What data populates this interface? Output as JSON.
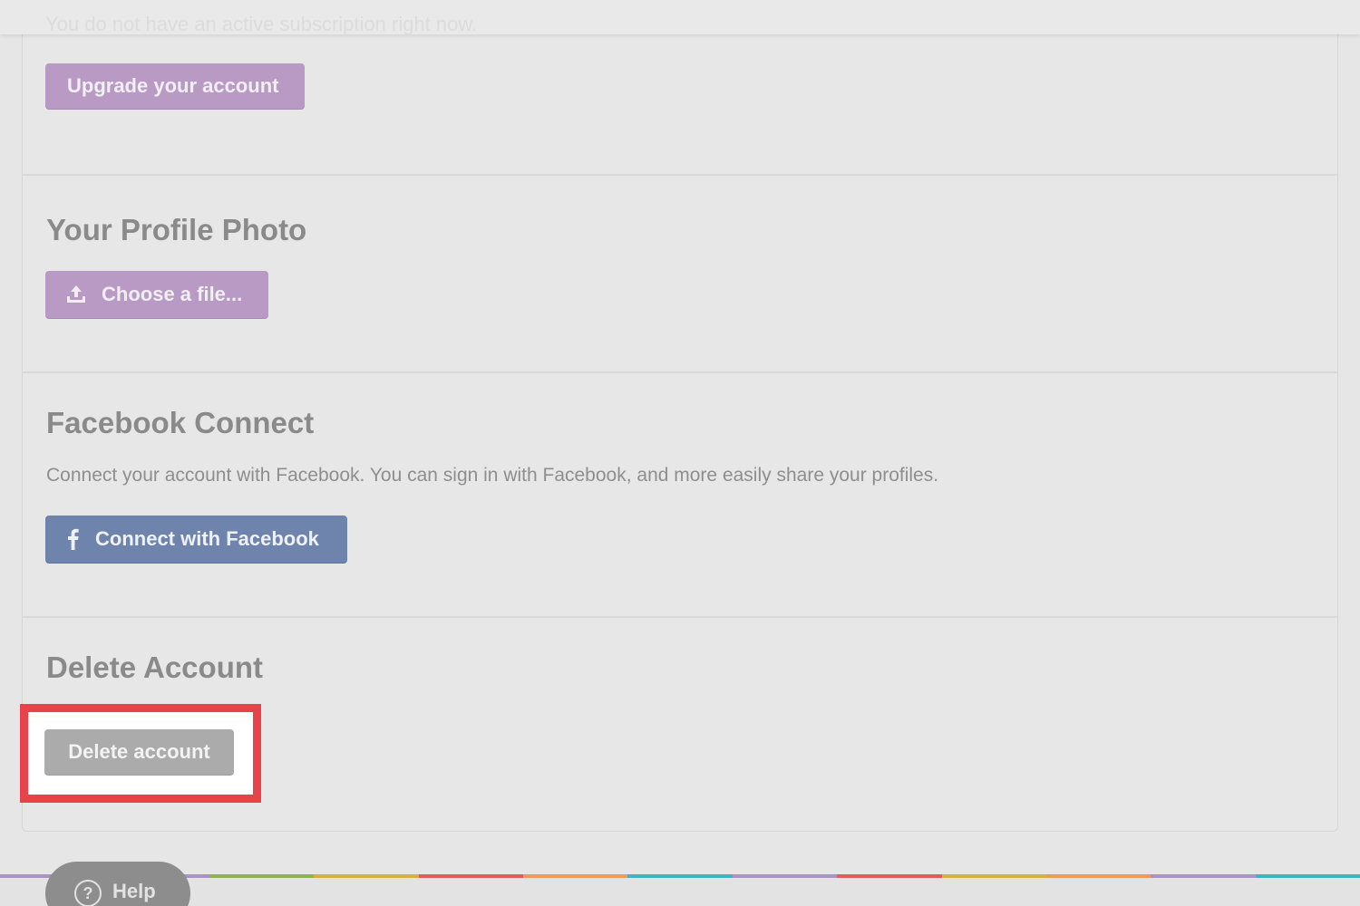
{
  "subscription": {
    "status_text": "You do not have an active subscription right now.",
    "upgrade_label": "Upgrade your account"
  },
  "profile_photo": {
    "heading": "Your Profile Photo",
    "choose_label": "Choose a file..."
  },
  "facebook": {
    "heading": "Facebook Connect",
    "description": "Connect your account with Facebook. You can sign in with Facebook, and more easily share your profiles.",
    "connect_label": "Connect with Facebook"
  },
  "delete": {
    "heading": "Delete Account",
    "button_label": "Delete account"
  },
  "help": {
    "label": "Help"
  },
  "colors": {
    "accent_purple": "#b99ac4",
    "facebook_blue": "#6f84ad",
    "highlight_red": "#e8434b",
    "rainbow": [
      "#a993c0",
      "#a993c0",
      "#8fb34f",
      "#d6b045",
      "#e55a5e",
      "#ec9a5a",
      "#42b3c6",
      "#a993c0",
      "#e55a5e",
      "#d6b045",
      "#ec9a5a",
      "#a993c0",
      "#42b3c6"
    ]
  }
}
